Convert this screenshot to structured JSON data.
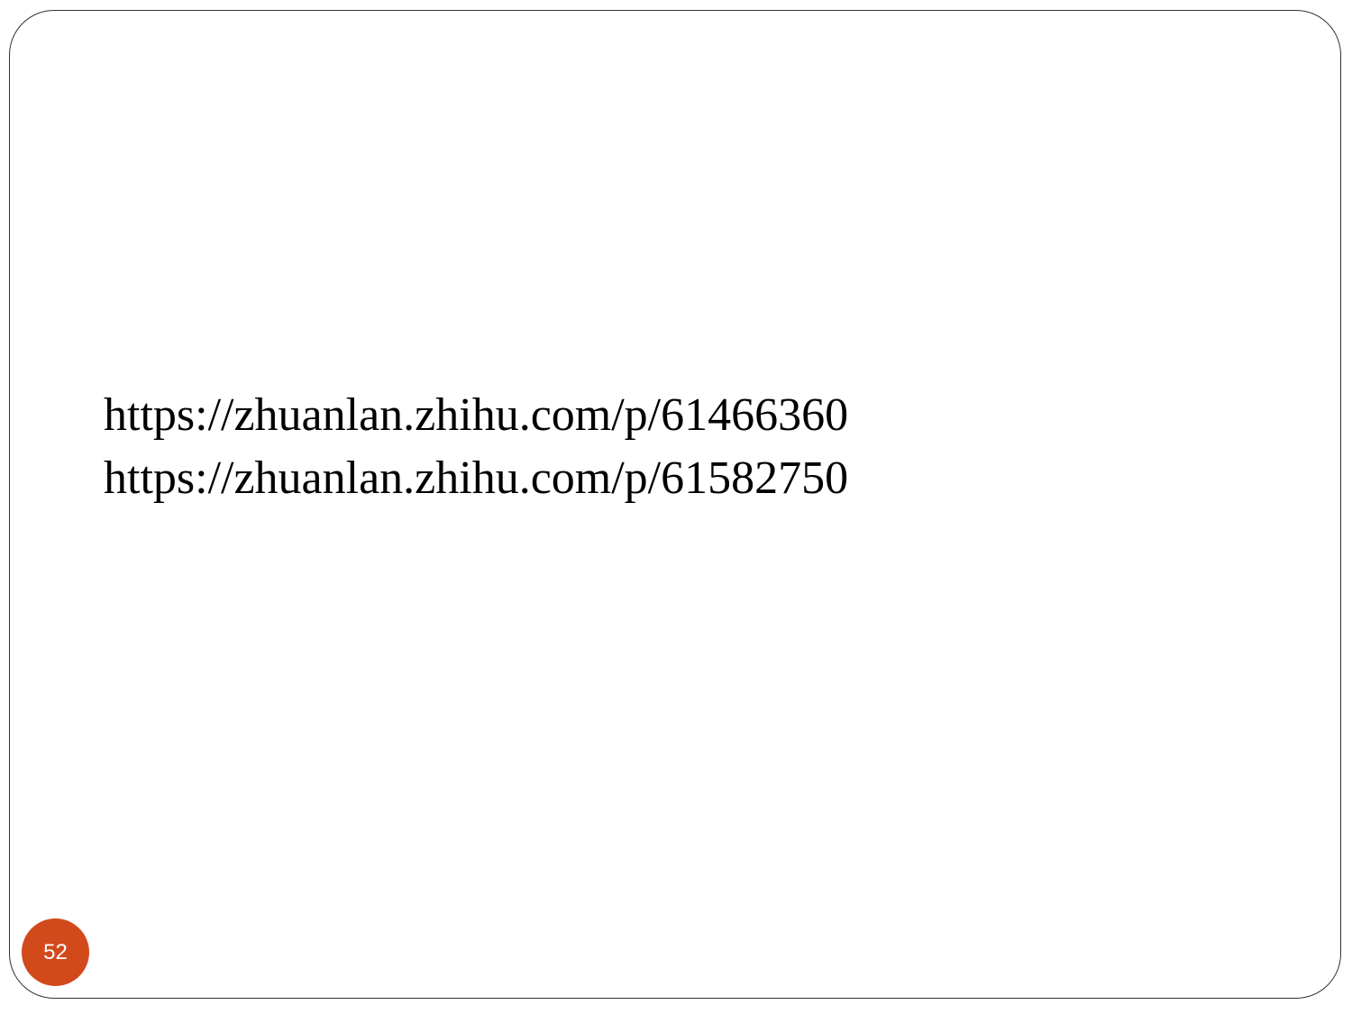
{
  "slide": {
    "links": [
      "https://zhuanlan.zhihu.com/p/61466360",
      "https://zhuanlan.zhihu.com/p/61582750"
    ],
    "page_number": "52"
  },
  "colors": {
    "badge_background": "#d24a1c",
    "frame_border": "#333333",
    "text": "#000000"
  }
}
